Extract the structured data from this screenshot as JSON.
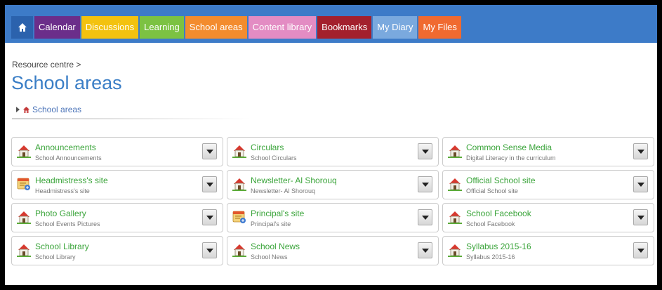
{
  "nav": {
    "home_icon": "home-icon",
    "tabs": [
      {
        "label": "Calendar",
        "color": "#6b2e8a"
      },
      {
        "label": "Discussions",
        "color": "#f3c20f"
      },
      {
        "label": "Learning",
        "color": "#7cc242"
      },
      {
        "label": "School areas",
        "color": "#f38c2e"
      },
      {
        "label": "Content library",
        "color": "#e38cc3"
      },
      {
        "label": "Bookmarks",
        "color": "#a3202d"
      },
      {
        "label": "My Diary",
        "color": "#7aa9de"
      },
      {
        "label": "My Files",
        "color": "#f06a30"
      }
    ]
  },
  "breadcrumb": "Resource centre >",
  "page_title": "School areas",
  "tree": {
    "label": "School areas"
  },
  "cards": [
    {
      "title": "Announcements",
      "desc": "School Announcements",
      "icon": "school-icon"
    },
    {
      "title": "Circulars",
      "desc": "School Circulars",
      "icon": "school-icon"
    },
    {
      "title": "Common Sense Media",
      "desc": "Digital Literacy in the curriculum",
      "icon": "school-icon"
    },
    {
      "title": "Headmistress's site",
      "desc": "Headmistress's site",
      "icon": "site-icon"
    },
    {
      "title": "Newsletter- Al Shorouq",
      "desc": "Newsletter- Al Shorouq",
      "icon": "school-icon"
    },
    {
      "title": "Official School site",
      "desc": "Official School site",
      "icon": "school-icon"
    },
    {
      "title": "Photo Gallery",
      "desc": "School Events Pictures",
      "icon": "school-icon"
    },
    {
      "title": "Principal's site",
      "desc": "Principal's site",
      "icon": "site-icon"
    },
    {
      "title": "School Facebook",
      "desc": "School Facebook",
      "icon": "school-icon"
    },
    {
      "title": "School Library",
      "desc": "School Library",
      "icon": "school-icon"
    },
    {
      "title": "School News",
      "desc": "School News",
      "icon": "school-icon"
    },
    {
      "title": "Syllabus 2015-16",
      "desc": "Syllabus 2015-16",
      "icon": "school-icon"
    }
  ]
}
